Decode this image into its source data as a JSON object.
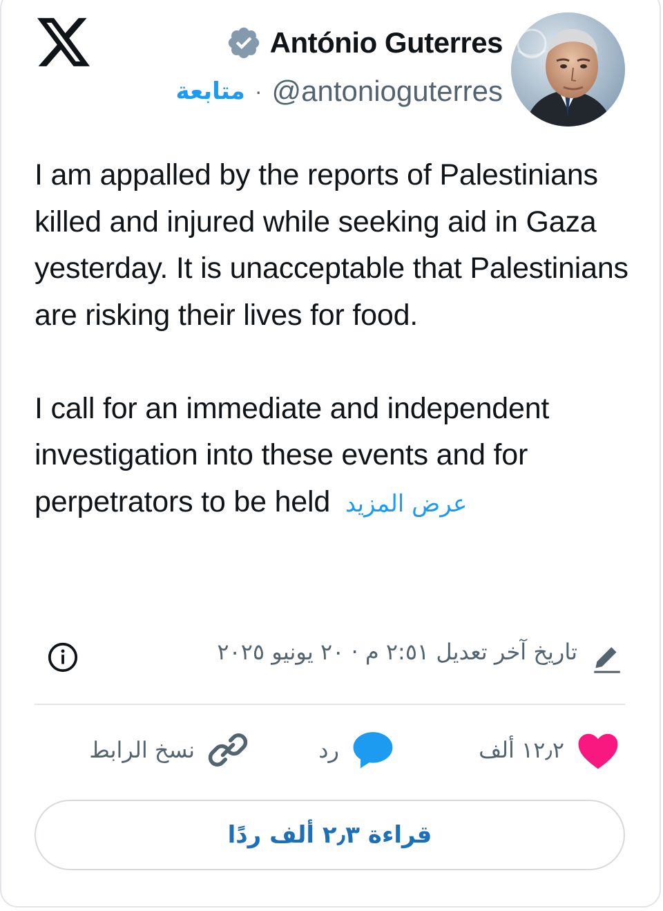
{
  "header": {
    "logo": "x-logo-icon",
    "author_name": "António Guterres",
    "verified": "verified-badge-icon",
    "handle": "@antonioguterres",
    "separator": "·",
    "follow_label": "متابعة",
    "avatar": "profile-photo"
  },
  "tweet": {
    "paragraph_1": "I am appalled by the reports of Palestinians killed and injured while seeking aid in Gaza yesterday. It is unacceptable that Palestinians are risking their lives for food.",
    "paragraph_2": "I call for an immediate and independent investigation into these events and for perpetrators to be held",
    "show_more": "عرض المزيد"
  },
  "edit_info": {
    "text": "تاريخ آخر تعديل ٢:٥١ م · ٢٠ يونيو ٢٠٢٥",
    "pencil_icon": "pencil-icon",
    "info_icon": "info-icon"
  },
  "actions": {
    "like_count": "١٢٫٢ ألف",
    "reply_label": "رد",
    "copy_link_label": "نسخ الرابط"
  },
  "replies_button": {
    "label": "قراءة ٢٫٣ ألف ردًا"
  },
  "colors": {
    "accent": "#1d9bf0",
    "like": "#f91880",
    "text": "#0f1419",
    "muted": "#536471",
    "border": "#e1e4e8"
  }
}
